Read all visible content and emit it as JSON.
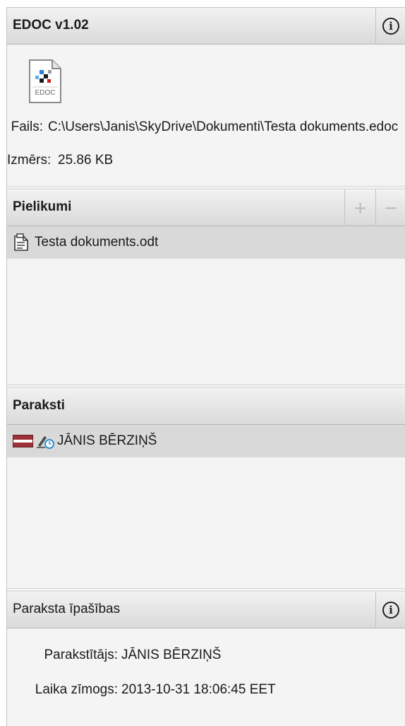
{
  "edoc_panel": {
    "title": "EDOC v1.02",
    "icon_caption": "EDOC",
    "file_label": "Fails:",
    "file_value": "C:\\Users\\Janis\\SkyDrive\\Dokumenti\\Testa dokuments.edoc",
    "size_label": "Izmērs:",
    "size_value": "25.86 KB",
    "info_icon": "info-icon"
  },
  "attachments_panel": {
    "title": "Pielikumi",
    "add_icon": "+",
    "remove_icon": "−",
    "items": [
      {
        "name": "Testa dokuments.odt",
        "icon": "document-icon"
      }
    ]
  },
  "signatures_panel": {
    "title": "Paraksti",
    "items": [
      {
        "name": "JĀNIS BĒRZIŅŠ",
        "flag": "latvia-flag-icon",
        "status_icon": "signature-timestamp-icon"
      }
    ]
  },
  "signature_props_panel": {
    "title": "Paraksta īpašības",
    "signer_label": "Parakstītājs:",
    "signer_value": "JĀNIS BĒRZIŅŠ",
    "timestamp_label": "Laika zīmogs:",
    "timestamp_value": "2013-10-31 18:06:45 EET"
  },
  "colors": {
    "latvia_carmine": "#9e3039",
    "selection": "#d9d9d9",
    "panel_bg": "#f4f4f4"
  }
}
